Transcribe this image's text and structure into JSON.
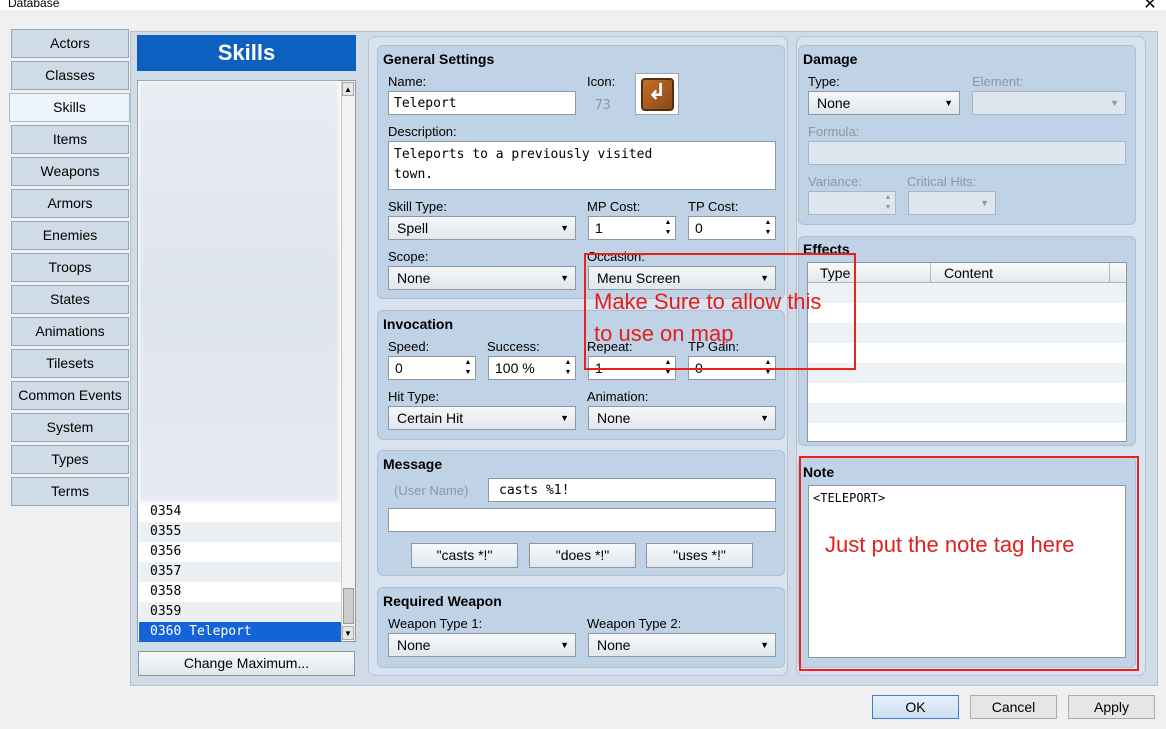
{
  "window": {
    "title": "Database",
    "close_glyph": "✕"
  },
  "tabs": [
    "Actors",
    "Classes",
    "Skills",
    "Items",
    "Weapons",
    "Armors",
    "Enemies",
    "Troops",
    "States",
    "Animations",
    "Tilesets",
    "Common Events",
    "System",
    "Types",
    "Terms"
  ],
  "active_tab": "Skills",
  "skills_header": "Skills",
  "list": {
    "rows": [
      "0354",
      "0355",
      "0356",
      "0357",
      "0358",
      "0359",
      "0360 Teleport"
    ],
    "selected": "0360 Teleport",
    "change_max_label": "Change Maximum..."
  },
  "general": {
    "title": "General Settings",
    "name_label": "Name:",
    "name_value": "Teleport",
    "icon_label": "Icon:",
    "icon_index": "73",
    "desc_label": "Description:",
    "desc_line1": "Teleports to a previously visited",
    "desc_line2": "town.",
    "skill_type_label": "Skill Type:",
    "skill_type_value": "Spell",
    "mp_cost_label": "MP Cost:",
    "mp_cost_value": "1",
    "tp_cost_label": "TP Cost:",
    "tp_cost_value": "0",
    "scope_label": "Scope:",
    "scope_value": "None",
    "occasion_label": "Occasion:",
    "occasion_value": "Menu Screen"
  },
  "invocation": {
    "title": "Invocation",
    "speed_label": "Speed:",
    "speed_value": "0",
    "success_label": "Success:",
    "success_value": "100 %",
    "repeat_label": "Repeat:",
    "repeat_value": "1",
    "tp_gain_label": "TP Gain:",
    "tp_gain_value": "0",
    "hit_type_label": "Hit Type:",
    "hit_type_value": "Certain Hit",
    "animation_label": "Animation:",
    "animation_value": "None"
  },
  "message": {
    "title": "Message",
    "user_name_label": "(User Name)",
    "line1": "casts %1!",
    "line2": "",
    "btn_casts": "\"casts *!\"",
    "btn_does": "\"does *!\"",
    "btn_uses": "\"uses *!\""
  },
  "required_weapon": {
    "title": "Required Weapon",
    "wt1_label": "Weapon Type 1:",
    "wt1_value": "None",
    "wt2_label": "Weapon Type 2:",
    "wt2_value": "None"
  },
  "damage": {
    "title": "Damage",
    "type_label": "Type:",
    "type_value": "None",
    "element_label": "Element:",
    "element_value": "",
    "formula_label": "Formula:",
    "variance_label": "Variance:",
    "critical_label": "Critical Hits:"
  },
  "effects": {
    "title": "Effects",
    "col_type": "Type",
    "col_content": "Content"
  },
  "note": {
    "title": "Note",
    "value": "<TELEPORT>"
  },
  "annotations": {
    "occasion_text_1": "Make Sure to allow this",
    "occasion_text_2": "to use on map",
    "note_text": "Just put the note tag here",
    "color": "#e8231d"
  },
  "buttons": {
    "ok": "OK",
    "cancel": "Cancel",
    "apply": "Apply"
  },
  "glyphs": {
    "down": "▼",
    "up": "▲"
  }
}
